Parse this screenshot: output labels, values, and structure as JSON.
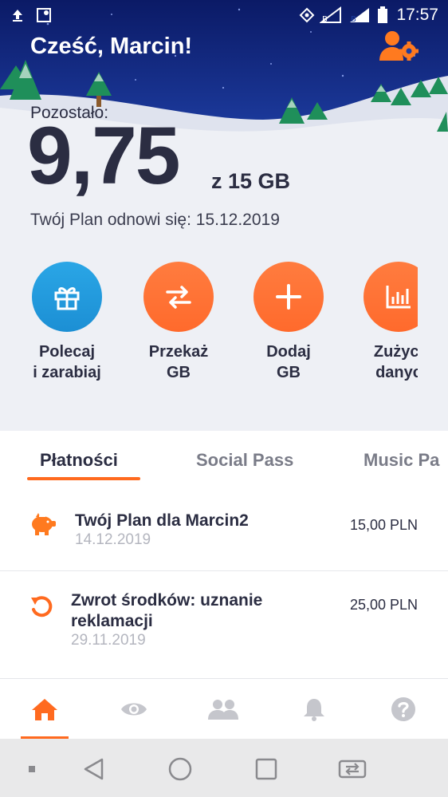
{
  "status_bar": {
    "time": "17:57",
    "icons": [
      "upload-icon",
      "map-pin-icon",
      "vpn-key-icon",
      "signal-icon",
      "battery-icon"
    ]
  },
  "header": {
    "greeting": "Cześć, Marcin!",
    "settings_icon": "user-gear-icon"
  },
  "data_usage": {
    "remaining_label": "Pozostało:",
    "remaining_value": "9,75",
    "total_text": "z 15 GB",
    "renew_text": "Twój Plan odnowi się: 15.12.2019"
  },
  "actions": [
    {
      "line1": "Polecaj",
      "line2": "i zarabiaj",
      "icon": "gift-icon",
      "color": "#2196db"
    },
    {
      "line1": "Przekaż",
      "line2": "GB",
      "icon": "transfer-icon",
      "color": "#ff6f33"
    },
    {
      "line1": "Dodaj",
      "line2": "GB",
      "icon": "plus-icon",
      "color": "#ff6f33"
    },
    {
      "line1": "Zużyci",
      "line2": "danyc",
      "icon": "bar-chart-icon",
      "color": "#ff6f33"
    }
  ],
  "tabs": [
    {
      "label": "Płatności",
      "active": true
    },
    {
      "label": "Social Pass",
      "active": false
    },
    {
      "label": "Music Pa",
      "active": false
    }
  ],
  "payments": [
    {
      "title_line1": "Twój Plan dla Marcin2",
      "title_line2": "",
      "date": "14.12.2019",
      "amount": "15,00 PLN",
      "icon": "piggy-bank-icon"
    },
    {
      "title_line1": "Zwrot środków: uznanie",
      "title_line2": "reklamacji",
      "date": "29.11.2019",
      "amount": "25,00 PLN",
      "icon": "refund-icon"
    }
  ],
  "bottom_nav": [
    {
      "name": "home",
      "icon": "home-icon",
      "active": true
    },
    {
      "name": "view",
      "icon": "eye-icon",
      "active": false
    },
    {
      "name": "friends",
      "icon": "people-icon",
      "active": false
    },
    {
      "name": "notifications",
      "icon": "bell-icon",
      "active": false
    },
    {
      "name": "help",
      "icon": "help-icon",
      "active": false
    }
  ],
  "colors": {
    "accent": "#ff6a1f",
    "sky_top": "#0c1f6e",
    "text_dark": "#2b2d42"
  }
}
